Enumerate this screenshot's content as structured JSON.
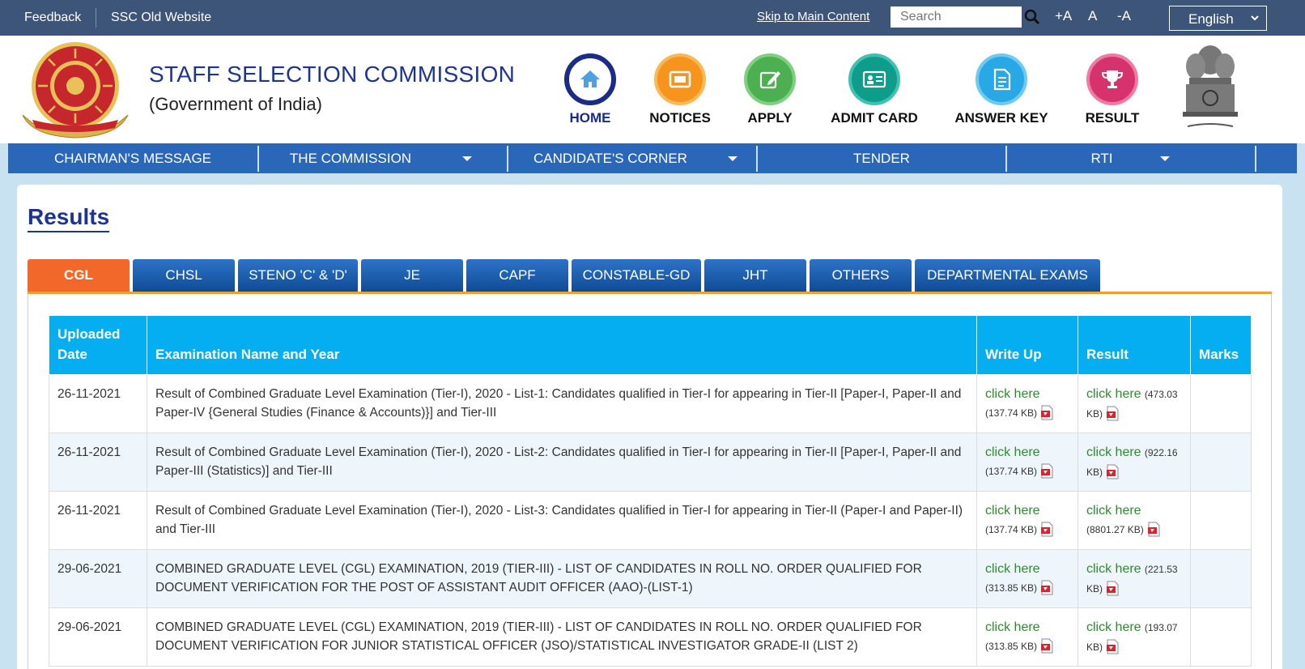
{
  "topbar": {
    "feedback": "Feedback",
    "old_site": "SSC Old Website",
    "skip": "Skip to Main Content",
    "search_placeholder": "Search",
    "font_increase": "+A",
    "font_normal": "A",
    "font_decrease": "-A",
    "language": "English"
  },
  "header": {
    "org_name": "STAFF SELECTION COMMISSION",
    "org_sub": "(Government of India)",
    "nav": [
      {
        "label": "HOME",
        "icon": "home-icon",
        "color": "#1a2b8a"
      },
      {
        "label": "NOTICES",
        "icon": "notice-icon",
        "color": "#f7941d"
      },
      {
        "label": "APPLY",
        "icon": "edit-icon",
        "color": "#4caf50"
      },
      {
        "label": "ADMIT CARD",
        "icon": "id-card-icon",
        "color": "#0e9c8b"
      },
      {
        "label": "ANSWER KEY",
        "icon": "document-icon",
        "color": "#29a8e6"
      },
      {
        "label": "RESULT",
        "icon": "trophy-icon",
        "color": "#d6336c"
      }
    ]
  },
  "mainnav": {
    "items": [
      "CHAIRMAN'S MESSAGE",
      "THE COMMISSION",
      "CANDIDATE'S CORNER",
      "TENDER",
      "RTI"
    ]
  },
  "page": {
    "title": "Results"
  },
  "tabs": [
    "CGL",
    "CHSL",
    "STENO 'C' & 'D'",
    "JE",
    "CAPF",
    "CONSTABLE-GD",
    "JHT",
    "OTHERS",
    "DEPARTMENTAL EXAMS"
  ],
  "table": {
    "headers": {
      "date": "Uploaded Date",
      "exam": "Examination Name and Year",
      "writeup": "Write Up",
      "result": "Result",
      "marks": "Marks"
    },
    "link_text": "click here",
    "rows": [
      {
        "date": "26-11-2021",
        "exam": "Result of Combined Graduate Level Examination (Tier-I), 2020 - List-1: Candidates qualified in Tier-I for appearing in Tier-II [Paper-I, Paper-II and Paper-IV {General Studies (Finance & Accounts)}] and Tier-III",
        "writeup_size": "(137.74 KB)",
        "result_size": "(473.03 KB)"
      },
      {
        "date": "26-11-2021",
        "exam": "Result of Combined Graduate Level Examination (Tier-I), 2020 - List-2: Candidates qualified in Tier-I for appearing in Tier-II [Paper-I, Paper-II and Paper-III (Statistics)] and Tier-III",
        "writeup_size": "(137.74 KB)",
        "result_size": "(922.16 KB)"
      },
      {
        "date": "26-11-2021",
        "exam": "Result of Combined Graduate Level Examination (Tier-I), 2020 - List-3: Candidates qualified in Tier-I for appearing in Tier-II (Paper-I and Paper-II) and Tier-III",
        "writeup_size": "(137.74 KB)",
        "result_size": "(8801.27 KB)"
      },
      {
        "date": "29-06-2021",
        "exam": "COMBINED GRADUATE LEVEL (CGL) EXAMINATION, 2019 (TIER-III) - LIST OF CANDIDATES IN ROLL NO. ORDER QUALIFIED FOR DOCUMENT VERIFICATION FOR THE POST OF ASSISTANT AUDIT OFFICER (AAO)-(LIST-1)",
        "writeup_size": "(313.85 KB)",
        "result_size": "(221.53 KB)"
      },
      {
        "date": "29-06-2021",
        "exam": "COMBINED GRADUATE LEVEL (CGL) EXAMINATION, 2019 (TIER-III) - LIST OF CANDIDATES IN ROLL NO. ORDER QUALIFIED FOR DOCUMENT VERIFICATION FOR JUNIOR STATISTICAL OFFICER (JSO)/STATISTICAL INVESTIGATOR GRADE-II (LIST 2)",
        "writeup_size": "(313.85 KB)",
        "result_size": "(193.07 KB)"
      }
    ]
  }
}
